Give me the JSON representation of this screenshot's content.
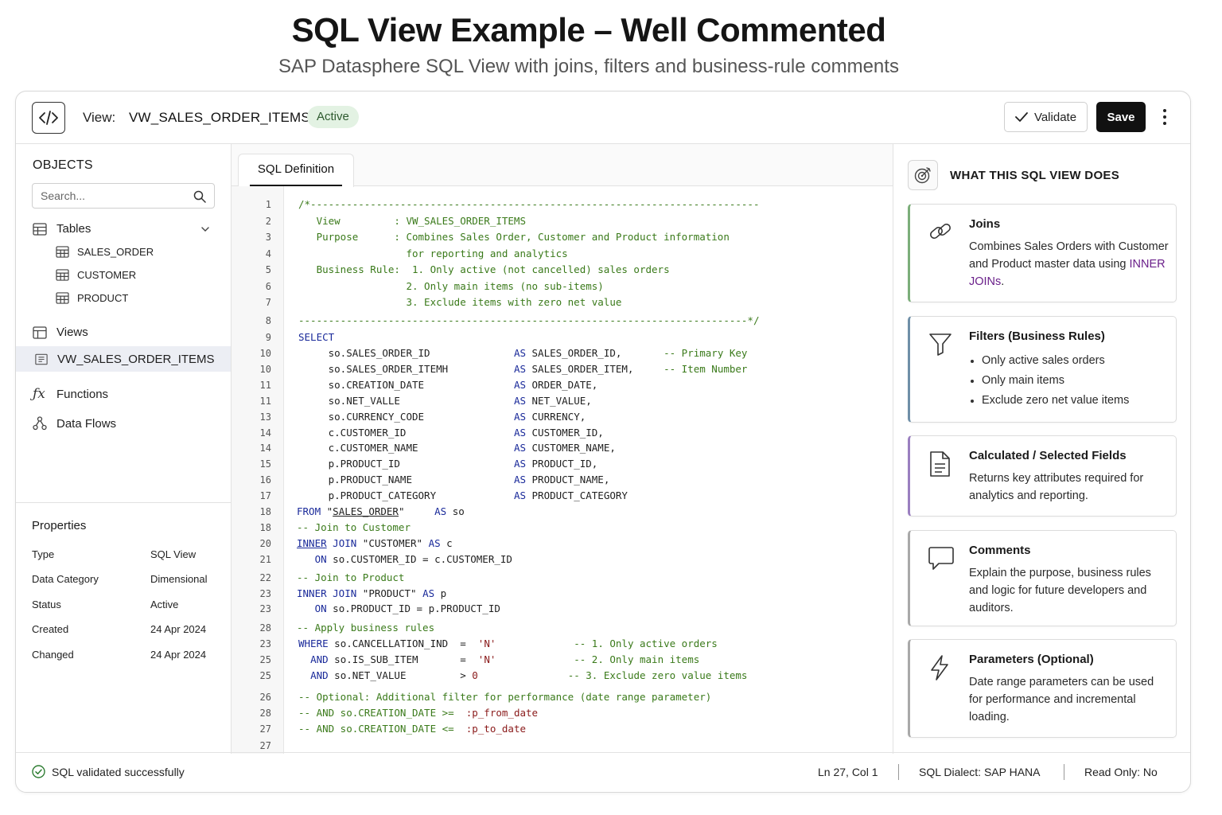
{
  "page": {
    "title": "SQL View Example – Well Commented",
    "subtitle": "SAP Datasphere SQL View with joins, filters and business-rule comments"
  },
  "topbar": {
    "view_label": "View:",
    "view_name": "VW_SALES_ORDER_ITEMS",
    "status": "Active",
    "validate_label": "Validate",
    "save_label": "Save"
  },
  "sidebar": {
    "title": "OBJECTS",
    "search_placeholder": "Search...",
    "tables_label": "Tables",
    "tables": [
      "SALES_ORDER",
      "CUSTOMER",
      "PRODUCT"
    ],
    "views_label": "Views",
    "views": [
      "VW_SALES_ORDER_ITEMS"
    ],
    "functions_label": "Functions",
    "dataflows_label": "Data Flows"
  },
  "properties": {
    "title": "Properties",
    "rows": [
      {
        "key": "Type",
        "value": "SQL View"
      },
      {
        "key": "Data Category",
        "value": "Dimensional"
      },
      {
        "key": "Status",
        "value": "Active"
      },
      {
        "key": "Created",
        "value": "24 Apr 2024"
      },
      {
        "key": "Changed",
        "value": "24 Apr 2024"
      }
    ]
  },
  "editor": {
    "tab_label": "SQL Definition",
    "line_numbers": [
      "1",
      "2",
      "3",
      "4",
      "5",
      "6",
      "7",
      "8",
      "9",
      "10",
      "10",
      "11",
      "11",
      "13",
      "14",
      "14",
      "15",
      "16",
      "17",
      "18",
      "18",
      "20",
      "21",
      "22",
      "23",
      "23",
      "28",
      "23",
      "25",
      "25",
      "26",
      "28",
      "27",
      "27"
    ]
  },
  "right_panel": {
    "title": "WHAT THIS SQL VIEW DOES",
    "cards": [
      {
        "title": "Joins",
        "body_pre": "Combines Sales Orders with Customer and Product master data using ",
        "body_highlight": "INNER JOINs",
        "body_post": ".",
        "accent": "#7cae7a"
      },
      {
        "title": "Filters (Business Rules)",
        "bullets": [
          "Only active sales orders",
          "Only main items",
          "Exclude zero net value items"
        ],
        "accent": "#6f8fa8"
      },
      {
        "title": "Calculated / Selected Fields",
        "body": "Returns key attributes required for analytics and reporting.",
        "accent": "#9a7fc0"
      },
      {
        "title": "Comments",
        "body": "Explain the purpose, business rules and logic for future developers and auditors.",
        "accent": "#a9a9a9"
      },
      {
        "title": "Parameters (Optional)",
        "body": "Date range parameters can be used for performance and incremental loading.",
        "accent": "#a9a9a9"
      }
    ]
  },
  "statusbar": {
    "message": "SQL validated successfully",
    "cursor": "Ln 27, Col 1",
    "dialect": "SQL Dialect: SAP HANA",
    "read_only": "Read Only: No"
  },
  "colors": {
    "comment": "#3a7a1a",
    "keyword": "#1a2a9a",
    "value": "#8a1a1a",
    "active_pill_bg": "#e3f2e3",
    "success": "#2e7d32"
  }
}
